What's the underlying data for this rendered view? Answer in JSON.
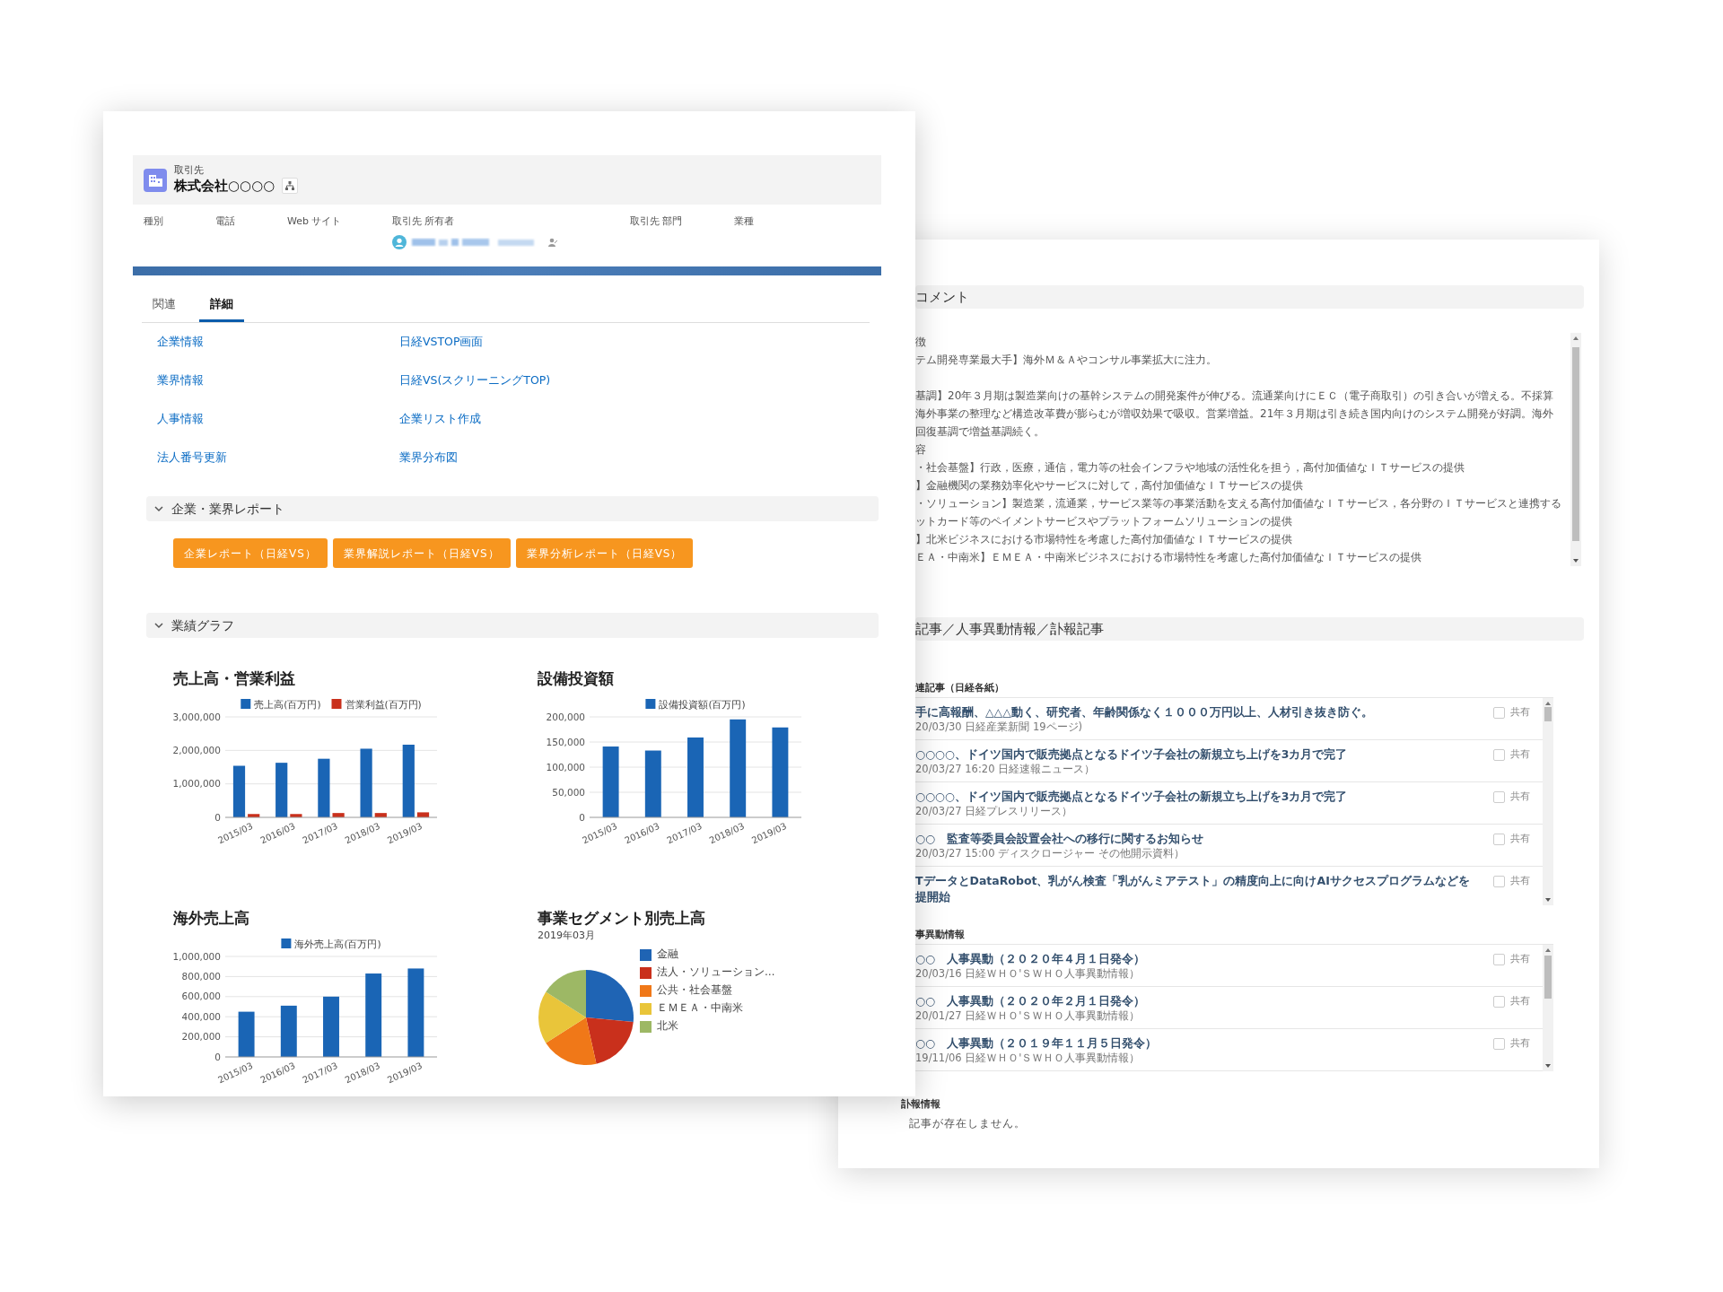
{
  "account": {
    "object_label": "取引先",
    "name": "株式会社○○○○"
  },
  "fields": [
    {
      "label": "種別",
      "kind": "text"
    },
    {
      "label": "電話",
      "kind": "text"
    },
    {
      "label": "Web サイト",
      "kind": "text"
    },
    {
      "label": "取引先 所有者",
      "kind": "owner"
    },
    {
      "label": "取引先 部門",
      "kind": "text"
    },
    {
      "label": "業種",
      "kind": "text"
    }
  ],
  "tabs": [
    {
      "label": "関連",
      "selected": false
    },
    {
      "label": "詳細",
      "selected": true
    }
  ],
  "links": [
    "企業情報",
    "日経VSTOP画面",
    "業界情報",
    "日経VS(スクリーニングTOP)",
    "人事情報",
    "企業リスト作成",
    "法人番号更新",
    "業界分布図"
  ],
  "sections": [
    {
      "title": "企業・業界レポート",
      "expanded": true,
      "buttons": [
        "企業レポート（日経VS）",
        "業界解説レポート（日経VS）",
        "業界分析レポート（日経VS）"
      ]
    },
    {
      "title": "業績グラフ",
      "expanded": true,
      "charts": [
        {
          "kind": "bar",
          "chart_data": {
            "type": "bar",
            "title": "売上高・営業利益",
            "categories": [
              "2015/03",
              "2016/03",
              "2017/03",
              "2018/03",
              "2019/03"
            ],
            "series": [
              {
                "name": "売上高(百万円)",
                "color": "#1a65b5",
                "values": [
                  1540000,
                  1630000,
                  1750000,
                  2050000,
                  2170000
                ]
              },
              {
                "name": "営業利益(百万円)",
                "color": "#c9301c",
                "values": [
                  100000,
                  100000,
                  130000,
                  130000,
                  150000
                ]
              }
            ],
            "ylim": [
              0,
              3000000
            ],
            "legend": "top",
            "grid": true,
            "yticks": [
              {
                "value": 0,
                "label": "0"
              },
              {
                "value": 1000000,
                "label": "1,000,000"
              },
              {
                "value": 2000000,
                "label": "2,000,000"
              },
              {
                "value": 3000000,
                "label": "3,000,000"
              }
            ]
          }
        },
        {
          "kind": "bar",
          "chart_data": {
            "type": "bar",
            "title": "設備投資額",
            "categories": [
              "2015/03",
              "2016/03",
              "2017/03",
              "2018/03",
              "2019/03"
            ],
            "series": [
              {
                "name": "設備投資額(百万円)",
                "color": "#1a65b5",
                "values": [
                  141000,
                  133000,
                  159000,
                  195000,
                  179000
                ]
              }
            ],
            "ylim": [
              0,
              200000
            ],
            "legend": "top",
            "grid": true,
            "yticks": [
              {
                "value": 0,
                "label": "0"
              },
              {
                "value": 50000,
                "label": "50,000"
              },
              {
                "value": 100000,
                "label": "100,000"
              },
              {
                "value": 150000,
                "label": "150,000"
              },
              {
                "value": 200000,
                "label": "200,000"
              }
            ]
          }
        },
        {
          "kind": "bar",
          "chart_data": {
            "type": "bar",
            "title": "海外売上高",
            "categories": [
              "2015/03",
              "2016/03",
              "2017/03",
              "2018/03",
              "2019/03"
            ],
            "series": [
              {
                "name": "海外売上高(百万円)",
                "color": "#1a65b5",
                "values": [
                  450000,
                  510000,
                  600000,
                  830000,
                  880000
                ]
              }
            ],
            "ylim": [
              0,
              1000000
            ],
            "legend": "top",
            "grid": true,
            "yticks": [
              {
                "value": 0,
                "label": "0"
              },
              {
                "value": 200000,
                "label": "200,000"
              },
              {
                "value": 400000,
                "label": "400,000"
              },
              {
                "value": 600000,
                "label": "600,000"
              },
              {
                "value": 800000,
                "label": "800,000"
              },
              {
                "value": 1000000,
                "label": "1,000,000"
              }
            ]
          }
        },
        {
          "kind": "pie",
          "title": "事業セグメント別売上高",
          "subtitle": "2019年03月",
          "legend": [
            {
              "label": "金融",
              "color": "#1f64b4"
            },
            {
              "label": "法人・ソリューション…",
              "color": "#c9301c"
            },
            {
              "label": "公共・社会基盤",
              "color": "#f07818"
            },
            {
              "label": "ＥＭＥＡ・中南米",
              "color": "#e9c53a"
            },
            {
              "label": "北米",
              "color": "#9db865"
            }
          ]
        }
      ]
    }
  ],
  "comment": {
    "title": "コメント",
    "paragraphs": [
      [
        "徴",
        "テム開発専業最大手】海外Ｍ＆Ａやコンサル事業拡大に注力。"
      ],
      [
        "基調】20年３月期は製造業向けの基幹システムの開発案件が伸びる。流通業向けにＥＣ（電子商取引）の引き合いが増える。不採算",
        "海外事業の整理など構造改革費が膨らむが増収効果で吸収。営業増益。21年３月期は引き続き国内向けのシステム開発が好調。海外",
        "回復基調で増益基調続く。",
        "容",
        "・社会基盤】行政，医療，通信，電力等の社会インフラや地域の活性化を担う，高付加価値なＩＴサービスの提供",
        "】金融機関の業務効率化やサービスに対して，高付加価値なＩＴサービスの提供",
        "・ソリューション】製造業，流通業，サービス業等の事業活動を支える高付加価値なＩＴサービス，各分野のＩＴサービスと連携する",
        "ットカード等のペイメントサービスやプラットフォームソリューションの提供",
        "】北米ビジネスにおける市場特性を考慮した高付加価値なＩＴサービスの提供",
        "ＥＡ・中南米】ＥＭＥＡ・中南米ビジネスにおける市場特性を考慮した高付加価値なＩＴサービスの提供"
      ]
    ]
  },
  "news": {
    "title": "記事／人事異動情報／訃報記事",
    "groups": [
      {
        "title": "連記事（日経各紙）",
        "kind": "list",
        "items": [
          {
            "title": "手に高報酬、△△△動く、研究者、年齢関係なく１０００万円以上、人材引き抜き防ぐ。",
            "source": "20/03/30 日経産業新聞 19ページ)",
            "checked": false,
            "check_label": "共有"
          },
          {
            "title": "○○○○、ドイツ国内で販売拠点となるドイツ子会社の新規立ち上げを3カ月で完了",
            "source": "20/03/27 16:20 日経速報ニュース）",
            "checked": false,
            "check_label": "共有"
          },
          {
            "title": "○○○○、ドイツ国内で販売拠点となるドイツ子会社の新規立ち上げを3カ月で完了",
            "source": "20/03/27 日経プレスリリース）",
            "checked": false,
            "check_label": "共有"
          },
          {
            "title": "○○　監査等委員会設置会社への移行に関するお知らせ",
            "source": "20/03/27 15:00 ディスクロージャー その他開示資料）",
            "checked": false,
            "check_label": "共有"
          },
          {
            "title": "TデータとDataRobot、乳がん検査「乳がんミアテスト」の精度向上に向けAIサクセスプログラムなどを提開始",
            "checked": false,
            "check_label": "共有"
          }
        ]
      },
      {
        "title": "事異動情報",
        "kind": "list",
        "items": [
          {
            "title": "○○　人事異動（２０２０年４月１日発令）",
            "source": "20/03/16 日経ＷＨＯ'ＳＷＨＯ人事異動情報）",
            "checked": false,
            "check_label": "共有"
          },
          {
            "title": "○○　人事異動（２０２０年２月１日発令）",
            "source": "20/01/27 日経ＷＨＯ'ＳＷＨＯ人事異動情報）",
            "checked": false,
            "check_label": "共有"
          },
          {
            "title": "○○　人事異動（２０１９年１１月５日発令）",
            "source": "19/11/06 日経ＷＨＯ'ＳＷＨＯ人事異動情報）",
            "checked": false,
            "check_label": "共有"
          }
        ]
      },
      {
        "title": "訃報情報",
        "kind": "empty",
        "message": "記事が存在しません。"
      }
    ]
  }
}
